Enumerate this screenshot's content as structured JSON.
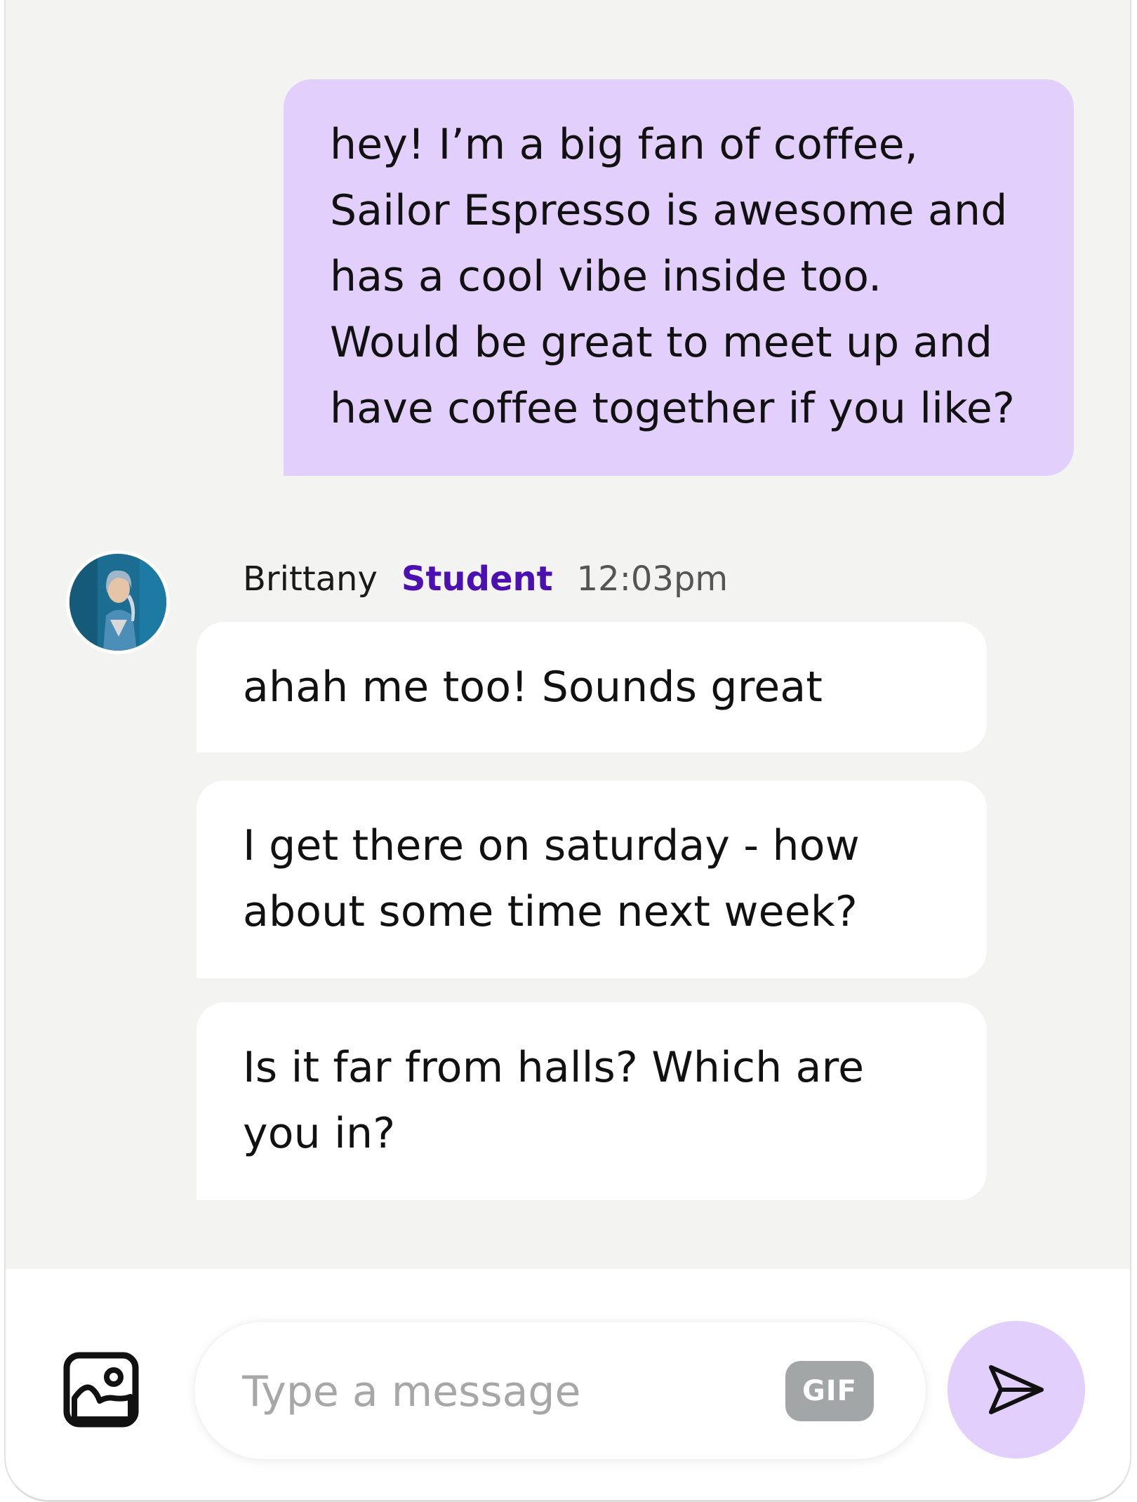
{
  "messages": {
    "sent": {
      "lines": [
        "hey! I’m a big fan of coffee,",
        "Sailor Espresso is awesome and",
        "has a cool vibe inside too.",
        "Would be great to meet up and",
        "have coffee together if you like?"
      ]
    },
    "received": {
      "sender_name": "Brittany",
      "sender_role": "Student",
      "timestamp": "12:03pm",
      "bubbles": [
        {
          "lines": [
            "ahah me too! Sounds great"
          ]
        },
        {
          "lines": [
            "I get there on saturday - how",
            "about some time next week?"
          ]
        },
        {
          "lines": [
            "Is it far from halls? Which are",
            "you in?"
          ]
        }
      ]
    }
  },
  "composer": {
    "placeholder": "Type a message",
    "gif_label": "GIF",
    "image_icon": "image-add-icon",
    "send_icon": "send-icon"
  },
  "colors": {
    "sent_bubble": "#e2cffb",
    "role_accent": "#4b0fb2",
    "chat_background": "#f3f3f1",
    "send_button": "#e2cffb"
  }
}
